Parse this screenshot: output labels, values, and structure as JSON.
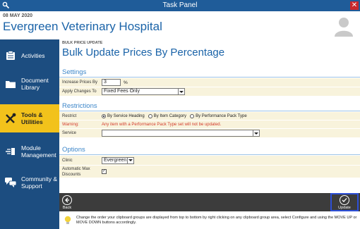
{
  "window": {
    "title": "Task Panel",
    "close_label": "✕"
  },
  "header": {
    "date": "08 MAY 2020",
    "clinic_name": "Evergreen Veterinary Hospital"
  },
  "sidebar": {
    "items": [
      {
        "label": "Activities",
        "icon": "clipboard-icon",
        "active": false
      },
      {
        "label": "Document Library",
        "icon": "folder-icon",
        "active": false
      },
      {
        "label": "Tools & Utilities",
        "icon": "tools-icon",
        "active": true
      },
      {
        "label": "Module Management",
        "icon": "module-icon",
        "active": false
      },
      {
        "label": "Community & Support",
        "icon": "chat-icon",
        "active": false
      }
    ]
  },
  "main": {
    "breadcrumb": "BULK PRICE UPDATE",
    "title": "Bulk Update Prices By Percentage",
    "settings": {
      "title": "Settings",
      "increase_label": "Increase Prices By",
      "increase_value": "3",
      "increase_unit": "%",
      "apply_label": "Apply Changes To",
      "apply_value": "Fixed Fees Only"
    },
    "restrictions": {
      "title": "Restrictions",
      "restrict_label": "Restrict",
      "options": [
        "By Service Heading",
        "By Item Category",
        "By Performance Pack Type"
      ],
      "selected_index": 0,
      "warning_label": "Warning:",
      "warning_text": "Any item with a Performance Pack Type set will not be updated.",
      "service_label": "Service",
      "service_value": ""
    },
    "options": {
      "title": "Options",
      "clinic_label": "Clinic",
      "clinic_value": "Evergreen",
      "auto_max_label": "Automatic Max Discounts",
      "auto_max_checked": true,
      "check_mark": "✓"
    }
  },
  "footer": {
    "back_label": "Back",
    "update_label": "Update"
  },
  "tip": {
    "text": "Change the order your clipboard groups are displayed from top to bottom by right clicking on any clipboard group area, select Configure and using the MOVE UP or MOVE DOWN buttons accordingly."
  },
  "colors": {
    "titlebar": "#1f5c99",
    "sidebar": "#1c4d80",
    "active_nav": "#f2c21b",
    "heading_blue": "#1a63a8",
    "warning_red": "#d23a2a",
    "footer_bar": "#3c3c3c"
  }
}
